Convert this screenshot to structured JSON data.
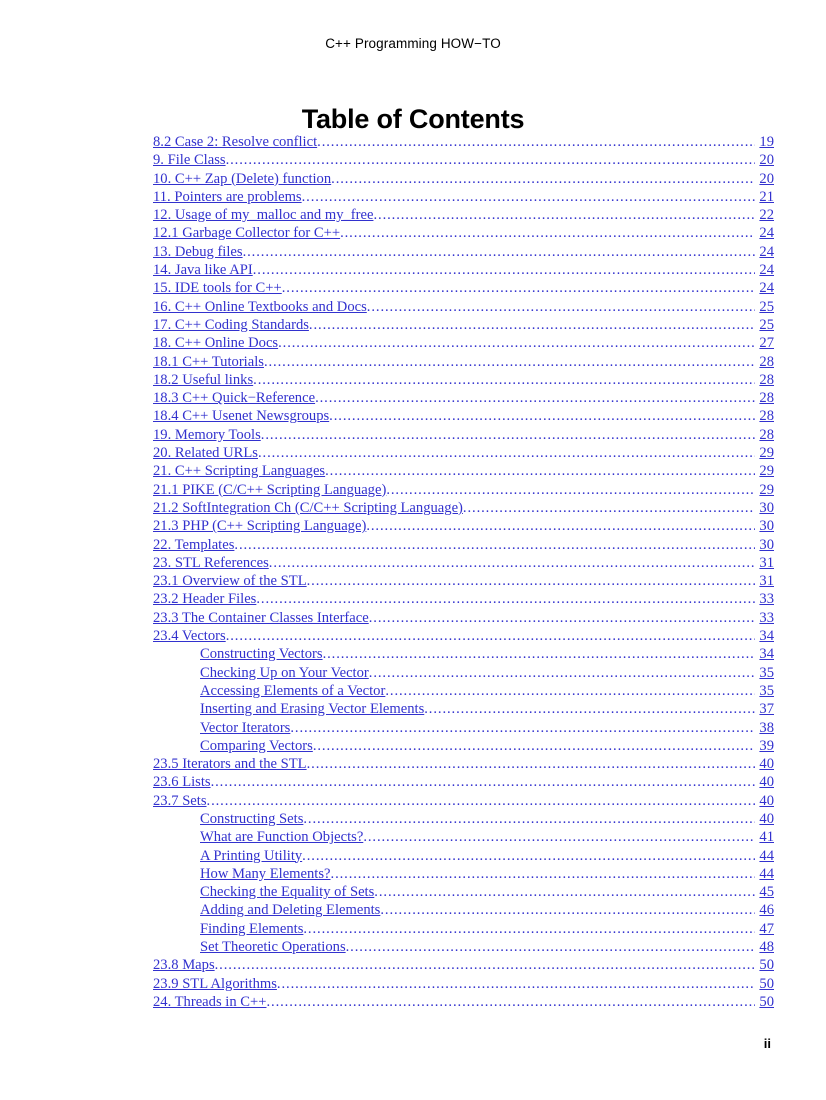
{
  "header": {
    "running_title": "C++ Programming HOW−TO"
  },
  "title": "Table of Contents",
  "footer": {
    "page_number": "ii"
  },
  "colors": {
    "link": "#3231CE",
    "text": "#000000",
    "background": "#FFFFFF"
  },
  "toc": {
    "entries": [
      {
        "label": "8.2 Case 2: Resolve conflict",
        "page": "19",
        "level": 0
      },
      {
        "label": "9. File Class",
        "page": "20",
        "level": 0
      },
      {
        "label": " 10. C++ Zap (Delete) function ",
        "page": "20",
        "level": 0
      },
      {
        "label": " 11. Pointers are problems ",
        "page": "21",
        "level": 0
      },
      {
        "label": " 12. Usage of my_malloc and my_free ",
        "page": "22",
        "level": 0
      },
      {
        "label": " 12.1 Garbage Collector for C++ ",
        "page": "24",
        "level": 0
      },
      {
        "label": "13. Debug files",
        "page": "24",
        "level": 0
      },
      {
        "label": "14. Java like API",
        "page": "24",
        "level": 0
      },
      {
        "label": " 15. IDE tools for C++ ",
        "page": "24",
        "level": 0
      },
      {
        "label": " 16. C++ Online Textbooks and Docs ",
        "page": "25",
        "level": 0
      },
      {
        "label": "17. C++ Coding Standards",
        "page": "25",
        "level": 0
      },
      {
        "label": "18. C++ Online Docs",
        "page": "27",
        "level": 0
      },
      {
        "label": "18.1 C++ Tutorials",
        "page": "28",
        "level": 0
      },
      {
        "label": "18.2 Useful links",
        "page": "28",
        "level": 0
      },
      {
        "label": "18.3 C++ Quick−Reference",
        "page": "28",
        "level": 0
      },
      {
        "label": "18.4 C++ Usenet Newsgroups",
        "page": "28",
        "level": 0
      },
      {
        "label": "19. Memory Tools",
        "page": "28",
        "level": 0
      },
      {
        "label": "20. Related URLs",
        "page": "29",
        "level": 0
      },
      {
        "label": "21. C++ Scripting Languages",
        "page": "29",
        "level": 0
      },
      {
        "label": "21.1 PIKE (C/C++ Scripting Language)",
        "page": "29",
        "level": 0
      },
      {
        "label": "21.2 SoftIntegration Ch (C/C++ Scripting Language)",
        "page": "30",
        "level": 0
      },
      {
        "label": "21.3 PHP (C++ Scripting Language)",
        "page": "30",
        "level": 0
      },
      {
        "label": "22. Templates",
        "page": "30",
        "level": 0
      },
      {
        "label": " 23. STL References ",
        "page": "31",
        "level": 0
      },
      {
        "label": "23.1 Overview of the STL ",
        "page": "31",
        "level": 0
      },
      {
        "label": "23.2 Header Files",
        "page": "33",
        "level": 0
      },
      {
        "label": "23.3 The Container Classes Interface ",
        "page": "33",
        "level": 0
      },
      {
        "label": "23.4 Vectors ",
        "page": "34",
        "level": 0
      },
      {
        "label": "Constructing Vectors ",
        "page": "34",
        "level": 1
      },
      {
        "label": "Checking Up on Your Vector ",
        "page": "35",
        "level": 1
      },
      {
        "label": "Accessing Elements of a Vector ",
        "page": "35",
        "level": 1
      },
      {
        "label": "Inserting and Erasing Vector Elements ",
        "page": "37",
        "level": 1
      },
      {
        "label": "Vector Iterators ",
        "page": "38",
        "level": 1
      },
      {
        "label": "Comparing Vectors ",
        "page": "39",
        "level": 1
      },
      {
        "label": "23.5 Iterators and the STL",
        "page": "40",
        "level": 0
      },
      {
        "label": "23.6 Lists",
        "page": "40",
        "level": 0
      },
      {
        "label": "23.7 Sets",
        "page": "40",
        "level": 0
      },
      {
        "label": "Constructing Sets",
        "page": "40",
        "level": 1
      },
      {
        "label": "What are Function Objects?",
        "page": "41",
        "level": 1
      },
      {
        "label": "A Printing Utility",
        "page": "44",
        "level": 1
      },
      {
        "label": "How Many Elements?",
        "page": "44",
        "level": 1
      },
      {
        "label": "Checking the Equality of Sets",
        "page": "45",
        "level": 1
      },
      {
        "label": "Adding and Deleting Elements",
        "page": "46",
        "level": 1
      },
      {
        "label": "Finding Elements",
        "page": "47",
        "level": 1
      },
      {
        "label": "Set Theoretic Operations",
        "page": "48",
        "level": 1
      },
      {
        "label": "23.8 Maps",
        "page": "50",
        "level": 0
      },
      {
        "label": "23.9 STL Algorithms",
        "page": "50",
        "level": 0
      },
      {
        "label": "24. Threads in C++",
        "page": "50",
        "level": 0
      }
    ]
  }
}
